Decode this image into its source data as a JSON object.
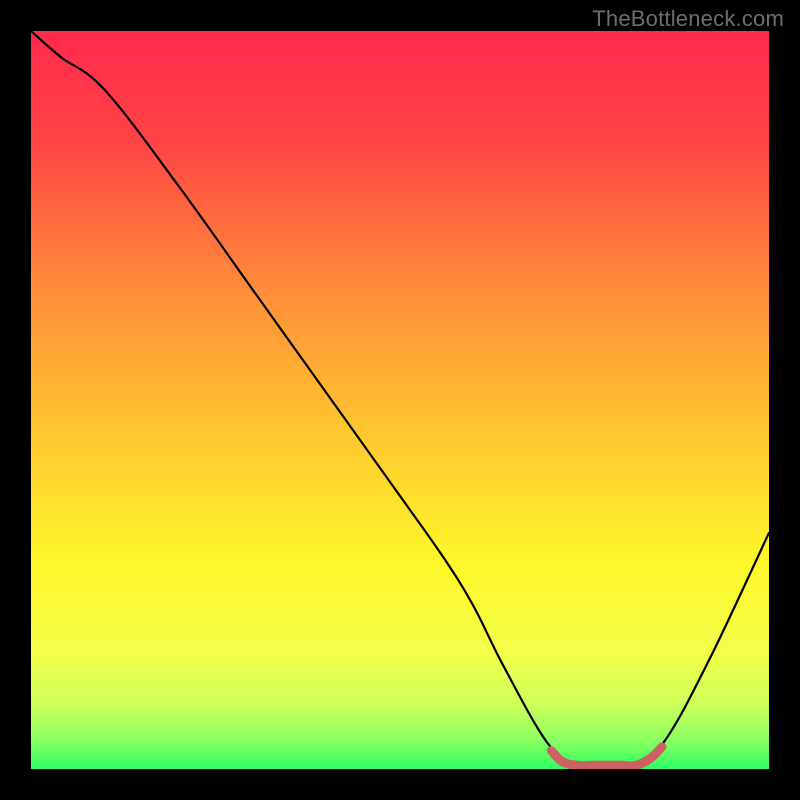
{
  "watermark": "TheBottleneck.com",
  "chart_data": {
    "type": "line",
    "title": "",
    "xlabel": "",
    "ylabel": "",
    "xlim": [
      0,
      100
    ],
    "ylim": [
      0,
      100
    ],
    "grid": false,
    "legend": false,
    "series": [
      {
        "name": "bottleneck-curve",
        "x": [
          0,
          4,
          10,
          20,
          30,
          40,
          50,
          56,
          60,
          64,
          70,
          74,
          78,
          82,
          86,
          92,
          100
        ],
        "values": [
          100,
          96.5,
          92,
          79,
          65,
          51,
          37,
          28.5,
          22,
          14,
          3.5,
          0.5,
          0.5,
          0.5,
          4,
          15,
          32
        ]
      },
      {
        "name": "sweet-spot",
        "x": [
          70.5,
          72,
          74,
          76,
          78,
          80,
          82,
          84,
          85.5
        ],
        "values": [
          2.5,
          1,
          0.5,
          0.5,
          0.5,
          0.5,
          0.5,
          1.5,
          3.0
        ]
      }
    ],
    "gradient_stops": [
      {
        "offset": 0.0,
        "color": "#ff2a4d"
      },
      {
        "offset": 0.15,
        "color": "#ff4445"
      },
      {
        "offset": 0.35,
        "color": "#ff8c3a"
      },
      {
        "offset": 0.55,
        "color": "#ffc82f"
      },
      {
        "offset": 0.72,
        "color": "#fff72a"
      },
      {
        "offset": 0.84,
        "color": "#f3ff4a"
      },
      {
        "offset": 0.91,
        "color": "#d0ff5a"
      },
      {
        "offset": 0.96,
        "color": "#8cff60"
      },
      {
        "offset": 1.0,
        "color": "#2dff64"
      }
    ],
    "colors": {
      "curve": "#000000",
      "sweet_spot": "#cc6161",
      "background_frame": "#000000"
    }
  }
}
